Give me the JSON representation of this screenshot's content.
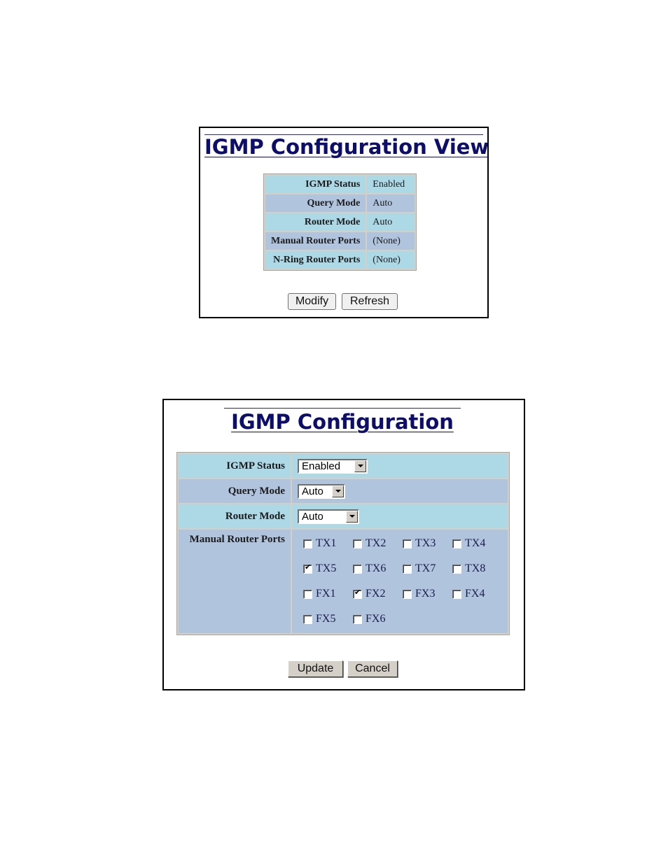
{
  "view_panel": {
    "title": "IGMP Configuration View",
    "rows": [
      {
        "label": "IGMP Status",
        "value": "Enabled"
      },
      {
        "label": "Query Mode",
        "value": "Auto"
      },
      {
        "label": "Router Mode",
        "value": "Auto"
      },
      {
        "label": "Manual Router Ports",
        "value": "(None)"
      },
      {
        "label": "N-Ring Router Ports",
        "value": "(None)"
      }
    ],
    "buttons": {
      "modify": "Modify",
      "refresh": "Refresh"
    }
  },
  "edit_panel": {
    "title": "IGMP Configuration",
    "fields": {
      "igmp_status": {
        "label": "IGMP Status",
        "selected": "Enabled"
      },
      "query_mode": {
        "label": "Query Mode",
        "selected": "Auto"
      },
      "router_mode": {
        "label": "Router Mode",
        "selected": "Auto"
      },
      "manual_router_ports": {
        "label": "Manual Router Ports",
        "ports": [
          {
            "name": "TX1",
            "checked": false
          },
          {
            "name": "TX2",
            "checked": false
          },
          {
            "name": "TX3",
            "checked": false
          },
          {
            "name": "TX4",
            "checked": false
          },
          {
            "name": "TX5",
            "checked": true
          },
          {
            "name": "TX6",
            "checked": false
          },
          {
            "name": "TX7",
            "checked": false
          },
          {
            "name": "TX8",
            "checked": false
          },
          {
            "name": "FX1",
            "checked": false
          },
          {
            "name": "FX2",
            "checked": true
          },
          {
            "name": "FX3",
            "checked": false
          },
          {
            "name": "FX4",
            "checked": false
          },
          {
            "name": "FX5",
            "checked": false
          },
          {
            "name": "FX6",
            "checked": false
          }
        ]
      }
    },
    "buttons": {
      "update": "Update",
      "cancel": "Cancel"
    }
  },
  "colors": {
    "row_light": "#add8e6",
    "row_dark": "#b0c4de",
    "title": "#0d0d6b"
  }
}
